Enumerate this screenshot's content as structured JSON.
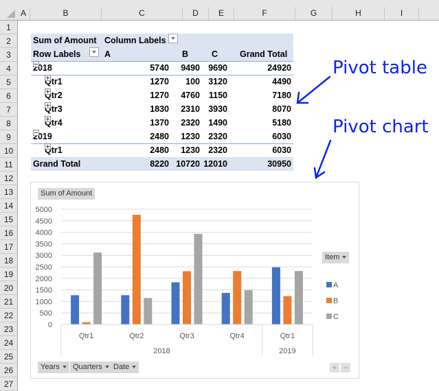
{
  "sheet": {
    "columns": [
      "A",
      "B",
      "C",
      "D",
      "E",
      "F",
      "G",
      "H",
      "I"
    ],
    "rows": [
      "1",
      "2",
      "3",
      "4",
      "5",
      "6",
      "7",
      "8",
      "9",
      "10",
      "11",
      "12",
      "13",
      "14",
      "15",
      "16",
      "17",
      "18",
      "19",
      "20",
      "21",
      "22",
      "23",
      "24",
      "25",
      "26",
      "27"
    ]
  },
  "pivot_table": {
    "value_label": "Sum of Amount",
    "column_labels": "Column Labels",
    "row_labels": "Row Labels",
    "headers": [
      "A",
      "B",
      "C",
      "Grand Total"
    ],
    "rows": [
      {
        "label": "2018",
        "level": 0,
        "toggle": "minus",
        "values": [
          "5740",
          "9490",
          "9690",
          "24920"
        ]
      },
      {
        "label": "Qtr1",
        "level": 1,
        "toggle": "plus",
        "values": [
          "1270",
          "100",
          "3120",
          "4490"
        ]
      },
      {
        "label": "Qtr2",
        "level": 1,
        "toggle": "plus",
        "values": [
          "1270",
          "4760",
          "1150",
          "7180"
        ]
      },
      {
        "label": "Qtr3",
        "level": 1,
        "toggle": "plus",
        "values": [
          "1830",
          "2310",
          "3930",
          "8070"
        ]
      },
      {
        "label": "Qtr4",
        "level": 1,
        "toggle": "plus",
        "values": [
          "1370",
          "2320",
          "1490",
          "5180"
        ]
      },
      {
        "label": "2019",
        "level": 0,
        "toggle": "minus",
        "values": [
          "2480",
          "1230",
          "2320",
          "6030"
        ]
      },
      {
        "label": "Qtr1",
        "level": 1,
        "toggle": "plus",
        "values": [
          "2480",
          "1230",
          "2320",
          "6030"
        ]
      }
    ],
    "grand_total": {
      "label": "Grand Total",
      "values": [
        "8220",
        "10720",
        "12010",
        "30950"
      ]
    }
  },
  "annotations": {
    "pivot_table": "Pivot table",
    "pivot_chart": "Pivot chart",
    "color": "#0a24f2"
  },
  "chart_controls": {
    "value_button": "Sum of Amount",
    "legend_button": "Item",
    "axis_buttons": [
      "Years",
      "Quarters",
      "Date"
    ],
    "zoom_in": "+",
    "zoom_out": "−"
  },
  "chart_data": {
    "type": "bar",
    "title": "",
    "xlabel": "",
    "ylabel": "",
    "ylim": [
      0,
      5000
    ],
    "yticks": [
      0,
      500,
      1000,
      1500,
      2000,
      2500,
      3000,
      3500,
      4000,
      4500,
      5000
    ],
    "grid": true,
    "legend": "right",
    "categories": [
      "Qtr1",
      "Qtr2",
      "Qtr3",
      "Qtr4",
      "Qtr1"
    ],
    "category_groups": [
      {
        "label": "2018",
        "span": 4
      },
      {
        "label": "2019",
        "span": 1
      }
    ],
    "series": [
      {
        "name": "A",
        "color": "#4472c4",
        "values": [
          1270,
          1270,
          1830,
          1370,
          2480
        ]
      },
      {
        "name": "B",
        "color": "#ed7d31",
        "values": [
          100,
          4760,
          2310,
          2320,
          1230
        ]
      },
      {
        "name": "C",
        "color": "#a5a5a5",
        "values": [
          3120,
          1150,
          3930,
          1490,
          2320
        ]
      }
    ]
  }
}
